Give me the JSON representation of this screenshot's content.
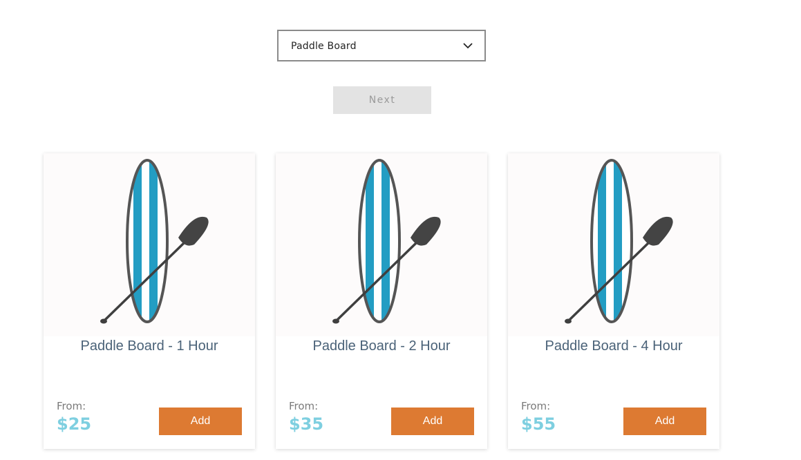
{
  "selector": {
    "value": "Paddle Board"
  },
  "next_label": "Next",
  "products": [
    {
      "title": "Paddle Board - 1 Hour",
      "from_label": "From:",
      "price": "$25",
      "add_label": "Add"
    },
    {
      "title": "Paddle Board - 2 Hour",
      "from_label": "From:",
      "price": "$35",
      "add_label": "Add"
    },
    {
      "title": "Paddle Board - 4 Hour",
      "from_label": "From:",
      "price": "$55",
      "add_label": "Add"
    }
  ],
  "colors": {
    "accent_button": "#dd7a32",
    "price": "#7ecfe0",
    "title": "#4a6278",
    "board_stripe": "#239dc3"
  },
  "icons": {
    "dropdown": "chevron-down-icon",
    "product_image": "paddle-board-icon"
  }
}
